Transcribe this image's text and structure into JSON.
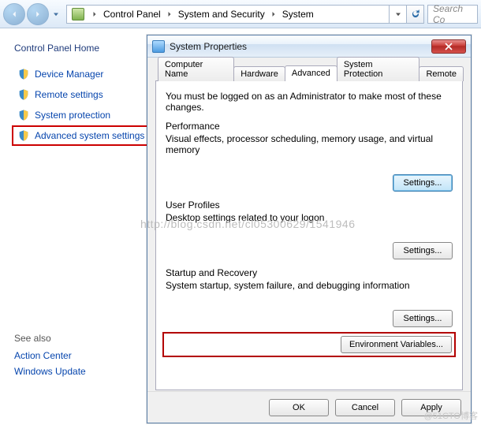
{
  "toolbar": {
    "breadcrumbs": {
      "seg1": "Control Panel",
      "seg2": "System and Security",
      "seg3": "System"
    },
    "search_placeholder": "Search Co"
  },
  "leftPane": {
    "home": "Control Panel Home",
    "tasks": {
      "device_manager": "Device Manager",
      "remote_settings": "Remote settings",
      "system_protection": "System protection",
      "advanced_system_settings": "Advanced system settings"
    },
    "see_also_header": "See also",
    "see_also": {
      "action_center": "Action Center",
      "windows_update": "Windows Update"
    }
  },
  "dialog": {
    "title": "System Properties",
    "tabs": {
      "computer_name": "Computer Name",
      "hardware": "Hardware",
      "advanced": "Advanced",
      "system_protection": "System Protection",
      "remote": "Remote"
    },
    "advanced_panel": {
      "intro": "You must be logged on as an Administrator to make most of these changes.",
      "performance": {
        "title": "Performance",
        "desc": "Visual effects, processor scheduling, memory usage, and virtual memory",
        "button": "Settings..."
      },
      "user_profiles": {
        "title": "User Profiles",
        "desc": "Desktop settings related to your logon",
        "button": "Settings..."
      },
      "startup": {
        "title": "Startup and Recovery",
        "desc": "System startup, system failure, and debugging information",
        "button": "Settings..."
      },
      "env_vars_button": "Environment Variables..."
    },
    "footer": {
      "ok": "OK",
      "cancel": "Cancel",
      "apply": "Apply"
    }
  },
  "watermarks": {
    "url": "http://blog.csdn.net/cl05300629/1541946",
    "corner": "@51CTO博客"
  }
}
